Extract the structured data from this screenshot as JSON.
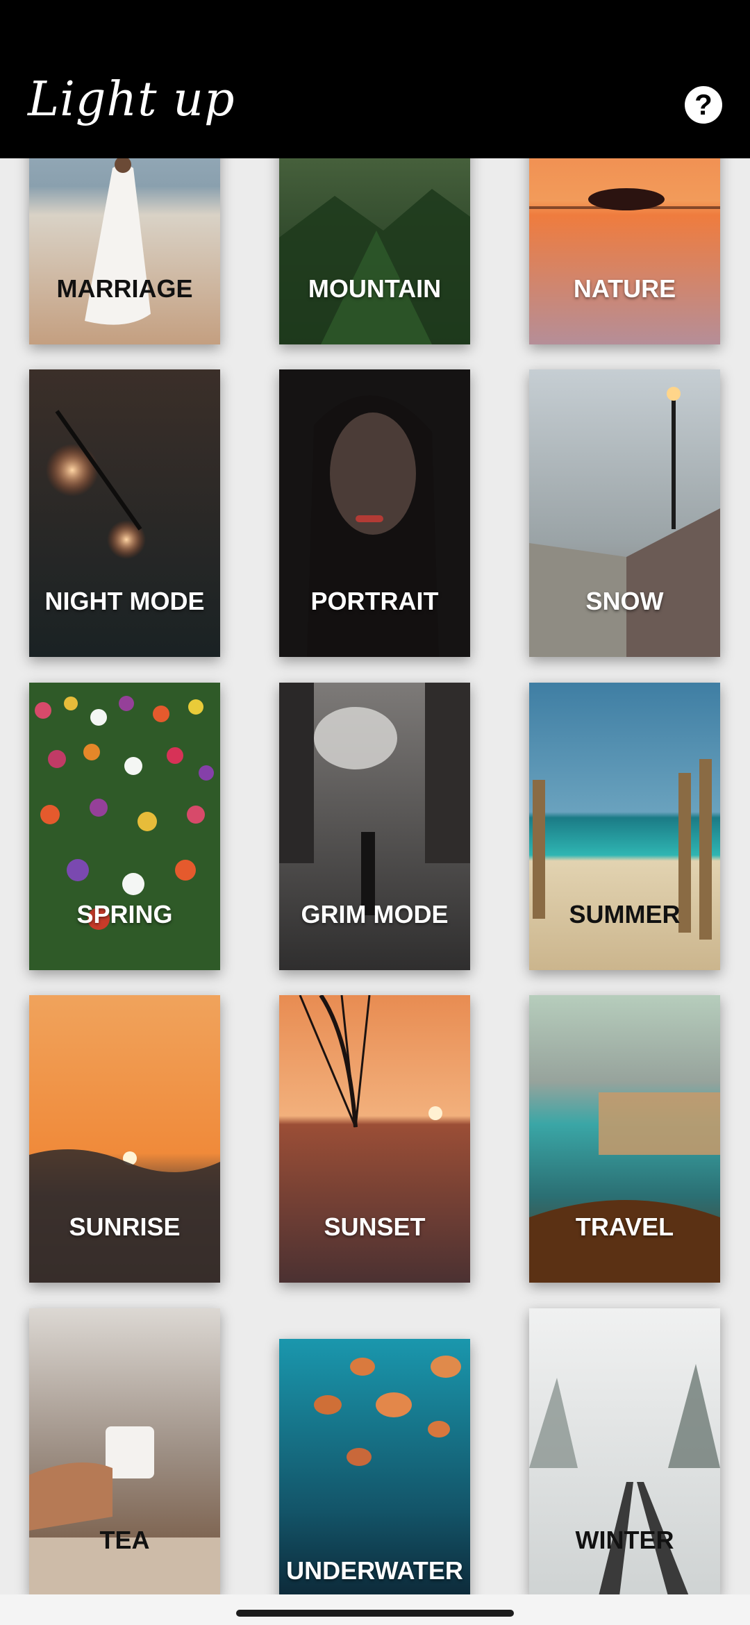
{
  "header": {
    "title": "Light up",
    "help_icon": "help-circle-icon",
    "help_glyph": "?"
  },
  "categories": [
    {
      "label": "MARRIAGE",
      "colors": {
        "top": "#9fb3c3",
        "bottom": "#c9a98a"
      }
    },
    {
      "label": "MOUNTAIN",
      "colors": {
        "top": "#2d4f2a",
        "bottom": "#1c3518"
      }
    },
    {
      "label": "NATURE",
      "colors": {
        "top": "#f29455",
        "bottom": "#b8838e"
      }
    },
    {
      "label": "NIGHT MODE",
      "colors": {
        "top": "#2b2623",
        "bottom": "#1e2426"
      }
    },
    {
      "label": "PORTRAIT",
      "colors": {
        "top": "#1a1717",
        "bottom": "#3a2f2c"
      }
    },
    {
      "label": "SNOW",
      "colors": {
        "top": "#b9c3c9",
        "bottom": "#7f6d66"
      }
    },
    {
      "label": "SPRING",
      "colors": {
        "top": "#d65a78",
        "bottom": "#2f5a28"
      }
    },
    {
      "label": "GRIM MODE",
      "colors": {
        "top": "#6c6a69",
        "bottom": "#2f2e2e"
      }
    },
    {
      "label": "SUMMER",
      "colors": {
        "top": "#4d86a6",
        "bottom": "#dac7a1"
      }
    },
    {
      "label": "SUNRISE",
      "colors": {
        "top": "#f09e55",
        "bottom": "#2a2320"
      }
    },
    {
      "label": "SUNSET",
      "colors": {
        "top": "#f2a46b",
        "bottom": "#5a3a38"
      }
    },
    {
      "label": "TRAVEL",
      "colors": {
        "top": "#a9c3b4",
        "bottom": "#5b3114"
      }
    },
    {
      "label": "TEA",
      "colors": {
        "top": "#d8d4cf",
        "bottom": "#6b4a32"
      }
    },
    {
      "label": "UNDERWATER",
      "colors": {
        "top": "#1f8ea4",
        "bottom": "#0c1e2d"
      }
    },
    {
      "label": "WINTER",
      "colors": {
        "top": "#eef0f0",
        "bottom": "#cfd2d2"
      }
    }
  ]
}
